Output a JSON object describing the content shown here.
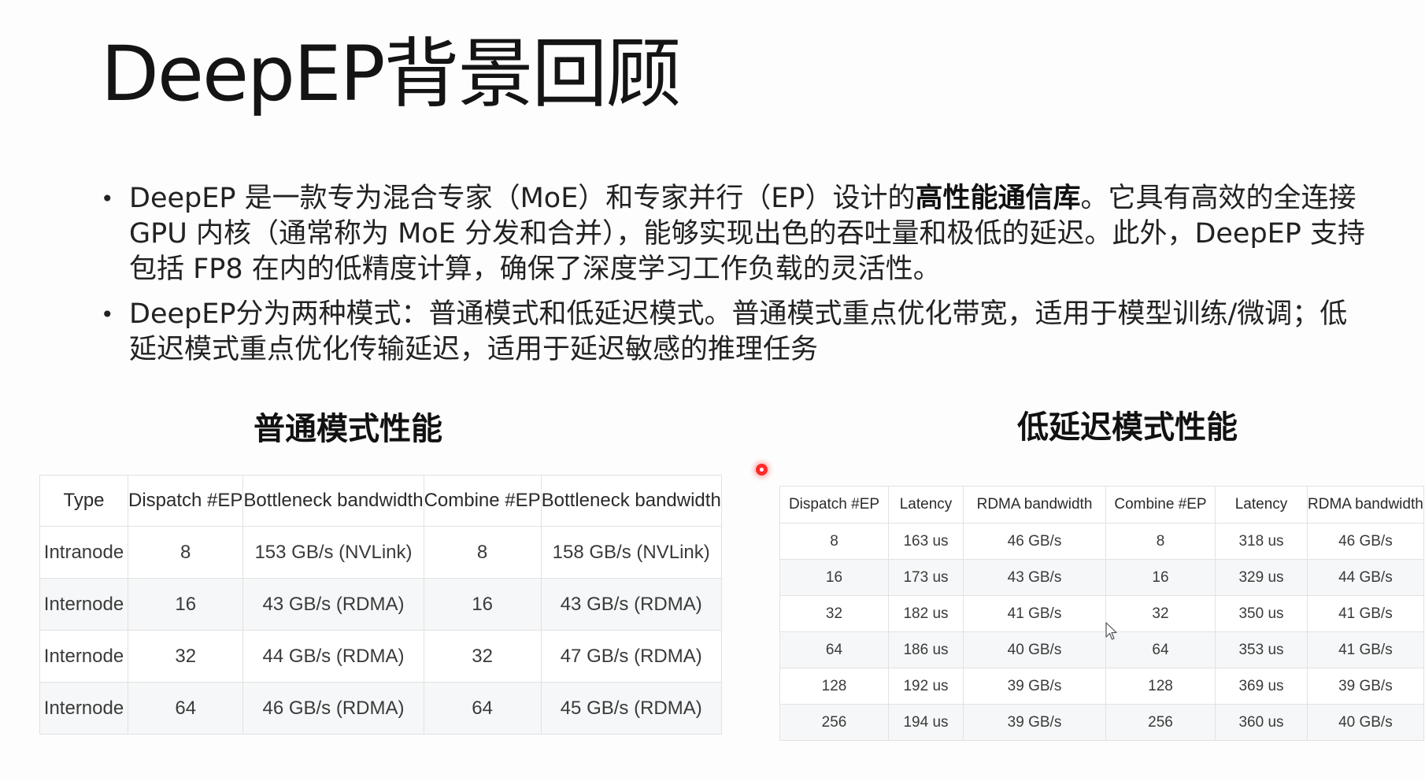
{
  "slide": {
    "title": "DeepEP背景回顾",
    "bullets": [
      {
        "before": "DeepEP 是一款专为混合专家（MoE）和专家并行（EP）设计的",
        "bold": "高性能通信库",
        "after": "。它具有高效的全连接 GPU 内核（通常称为 MoE 分发和合并），能够实现出色的吞吐量和极低的延迟。此外，DeepEP 支持包括 FP8 在内的低精度计算，确保了深度学习工作负载的灵活性。"
      },
      {
        "before": "DeepEP分为两种模式：普通模式和低延迟模式。普通模式重点优化带宽，适用于模型训练/微调；低延迟模式重点优化传输延迟，适用于延迟敏感的推理任务",
        "bold": "",
        "after": ""
      }
    ]
  },
  "normal_table": {
    "title": "普通模式性能",
    "headers": [
      "Type",
      "Dispatch #EP",
      "Bottleneck bandwidth",
      "Combine #EP",
      "Bottleneck bandwidth"
    ],
    "rows": [
      [
        "Intranode",
        "8",
        "153 GB/s (NVLink)",
        "8",
        "158 GB/s (NVLink)"
      ],
      [
        "Internode",
        "16",
        "43 GB/s (RDMA)",
        "16",
        "43 GB/s (RDMA)"
      ],
      [
        "Internode",
        "32",
        "44 GB/s (RDMA)",
        "32",
        "47 GB/s (RDMA)"
      ],
      [
        "Internode",
        "64",
        "46 GB/s (RDMA)",
        "64",
        "45 GB/s (RDMA)"
      ]
    ]
  },
  "low_latency_table": {
    "title": "低延迟模式性能",
    "headers": [
      "Dispatch #EP",
      "Latency",
      "RDMA bandwidth",
      "Combine #EP",
      "Latency",
      "RDMA bandwidth"
    ],
    "rows": [
      [
        "8",
        "163 us",
        "46 GB/s",
        "8",
        "318 us",
        "46 GB/s"
      ],
      [
        "16",
        "173 us",
        "43 GB/s",
        "16",
        "329 us",
        "44 GB/s"
      ],
      [
        "32",
        "182 us",
        "41 GB/s",
        "32",
        "350 us",
        "41 GB/s"
      ],
      [
        "64",
        "186 us",
        "40 GB/s",
        "64",
        "353 us",
        "41 GB/s"
      ],
      [
        "128",
        "192 us",
        "39 GB/s",
        "128",
        "369 us",
        "39 GB/s"
      ],
      [
        "256",
        "194 us",
        "39 GB/s",
        "256",
        "360 us",
        "40 GB/s"
      ]
    ]
  },
  "colors": {
    "laser_pointer": "#ff2a2a",
    "table_border": "#e2e2e2",
    "zebra_row": "#f6f7f8"
  }
}
